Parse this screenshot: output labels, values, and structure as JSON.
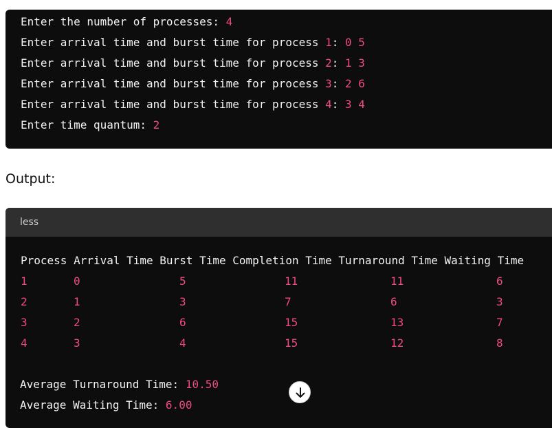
{
  "input_block": {
    "lines": [
      {
        "prompt": "Enter the number of processes: ",
        "value": "4"
      },
      {
        "prompt": "Enter arrival time and burst time for process ",
        "proc": "1",
        "colon": ": ",
        "value": "0 5"
      },
      {
        "prompt": "Enter arrival time and burst time for process ",
        "proc": "2",
        "colon": ": ",
        "value": "1 3"
      },
      {
        "prompt": "Enter arrival time and burst time for process ",
        "proc": "3",
        "colon": ": ",
        "value": "2 6"
      },
      {
        "prompt": "Enter arrival time and burst time for process ",
        "proc": "4",
        "colon": ": ",
        "value": "3 4"
      },
      {
        "prompt": "Enter time quantum: ",
        "value": "2"
      }
    ]
  },
  "output_heading": "Output:",
  "output_block": {
    "language": "less",
    "header": "Process Arrival Time Burst Time Completion Time Turnaround Time Waiting Time",
    "rows": [
      [
        "1",
        "0",
        "5",
        "11",
        "11",
        "6"
      ],
      [
        "2",
        "1",
        "3",
        "7",
        "6",
        "3"
      ],
      [
        "3",
        "2",
        "6",
        "15",
        "13",
        "7"
      ],
      [
        "4",
        "3",
        "4",
        "15",
        "12",
        "8"
      ]
    ],
    "avg_turnaround_label": "Average Turnaround Time: ",
    "avg_turnaround_value": "10.50",
    "avg_waiting_label": "Average Waiting Time: ",
    "avg_waiting_value": "6.00"
  },
  "icons": {
    "scroll_down": "arrow-down-icon"
  },
  "colors": {
    "code_bg": "#0d0d0d",
    "bar_bg": "#2f2f2f",
    "number": "#f04a85",
    "text": "#f3f3f3"
  }
}
